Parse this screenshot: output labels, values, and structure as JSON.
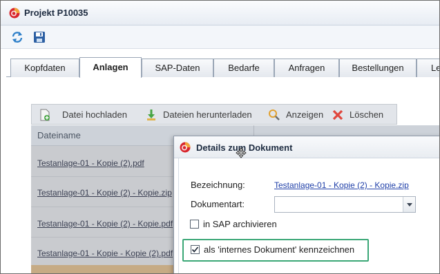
{
  "window": {
    "title": "Projekt P10035",
    "logo_icon": "app-logo-icon"
  },
  "toolbar": {
    "refresh_icon": "refresh-icon",
    "save_icon": "save-icon"
  },
  "tabs": [
    {
      "label": "Kopfdaten",
      "active": false
    },
    {
      "label": "Anlagen",
      "active": true
    },
    {
      "label": "SAP-Daten",
      "active": false
    },
    {
      "label": "Bedarfe",
      "active": false
    },
    {
      "label": "Anfragen",
      "active": false
    },
    {
      "label": "Bestellungen",
      "active": false
    },
    {
      "label": "Le",
      "active": false
    }
  ],
  "grid_toolbar": {
    "upload_label": "Datei hochladen",
    "download_label": "Dateien herunterladen",
    "view_label": "Anzeigen",
    "delete_label": "Löschen"
  },
  "grid": {
    "column_header": "Dateiname",
    "rows": [
      "Testanlage-01 - Kopie (2).pdf",
      "Testanlage-01 - Kopie (2) - Kopie.zip",
      "Testanlage-01 - Kopie (2) - Kopie.pdf",
      "Testanlage-01 - Kopie - Kopie (2).pdf"
    ]
  },
  "dialog": {
    "title": "Details zum Dokument",
    "bezeichnung_label": "Bezeichnung:",
    "bezeichnung_value": "Testanlage-01 - Kopie (2) - Kopie.zip",
    "dokumentart_label": "Dokumentart:",
    "dokumentart_value": "",
    "sap_archive_label": "in SAP archivieren",
    "sap_archive_checked": false,
    "internal_doc_label": "als 'internes Dokument' kennzeichnen",
    "internal_doc_checked": true
  },
  "colors": {
    "highlight": "#3aa776",
    "link": "#1f3fa8",
    "selected_row": "#c6ab85"
  }
}
